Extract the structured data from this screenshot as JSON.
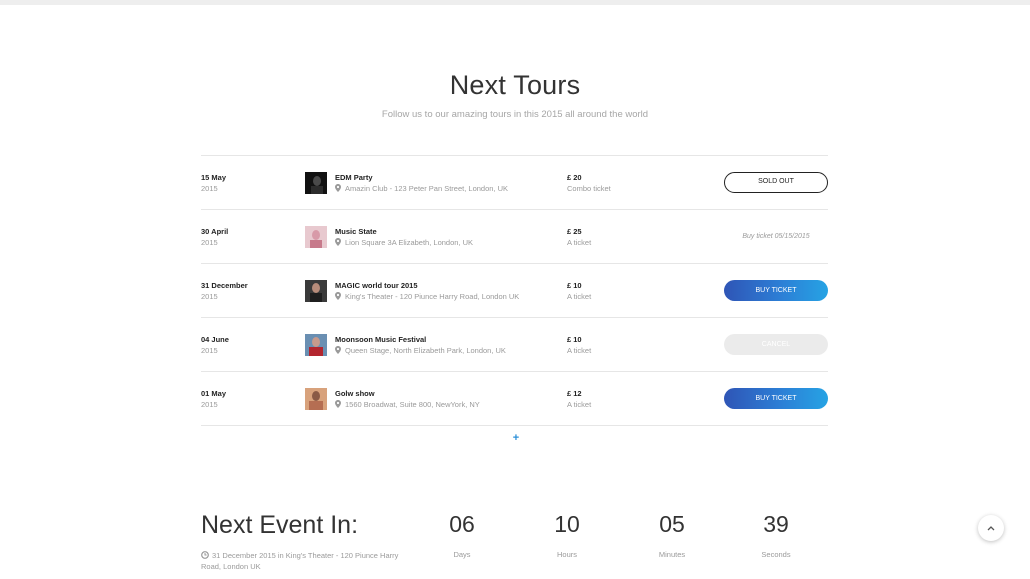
{
  "section": {
    "title": "Next Tours",
    "subtitle": "Follow us to our amazing tours in this 2015 all around the world"
  },
  "tours": [
    {
      "day": "15 May",
      "year": "2015",
      "name": "EDM Party",
      "venue": "Amazin Club - 123 Peter Pan Street, London, UK",
      "price": "£ 20",
      "price_type": "Combo ticket",
      "action": "SOLD OUT",
      "action_style": "outline"
    },
    {
      "day": "30 April",
      "year": "2015",
      "name": "Music State",
      "venue": "Lion Square 3A Elizabeth, London, UK",
      "price": "£ 25",
      "price_type": "A ticket",
      "action": "Buy ticket 05/15/2015",
      "action_style": "text"
    },
    {
      "day": "31 December",
      "year": "2015",
      "name": "MAGIC world tour 2015",
      "venue": "King's Theater - 120 Piunce Harry Road, London UK",
      "price": "£ 10",
      "price_type": "A ticket",
      "action": "BUY TICKET",
      "action_style": "gradient"
    },
    {
      "day": "04 June",
      "year": "2015",
      "name": "Moonsoon Music Festival",
      "venue": "Queen Stage, North Elizabeth Park, London, UK",
      "price": "£ 10",
      "price_type": "A ticket",
      "action": "CANCEL",
      "action_style": "disabled"
    },
    {
      "day": "01 May",
      "year": "2015",
      "name": "Golw show",
      "venue": "1560 Broadwat, Suite 800, NewYork, NY",
      "price": "£ 12",
      "price_type": "A ticket",
      "action": "BUY TICKET",
      "action_style": "gradient"
    }
  ],
  "load_more": {
    "icon": "plus-icon",
    "symbol": "+"
  },
  "next_event": {
    "title": "Next Event In:",
    "info": "31 December 2015 in King's Theater - 120 Piunce Harry Road, London UK",
    "countdown": [
      {
        "value": "06",
        "label": "Days"
      },
      {
        "value": "10",
        "label": "Hours"
      },
      {
        "value": "05",
        "label": "Minutes"
      },
      {
        "value": "39",
        "label": "Seconds"
      }
    ]
  },
  "scroll_top": {
    "icon": "chevron-up-icon"
  },
  "colors": {
    "accent_start": "#2f55b6",
    "accent_end": "#26a3e4",
    "text_dark": "#222222",
    "text_muted": "#9a9a9a"
  }
}
